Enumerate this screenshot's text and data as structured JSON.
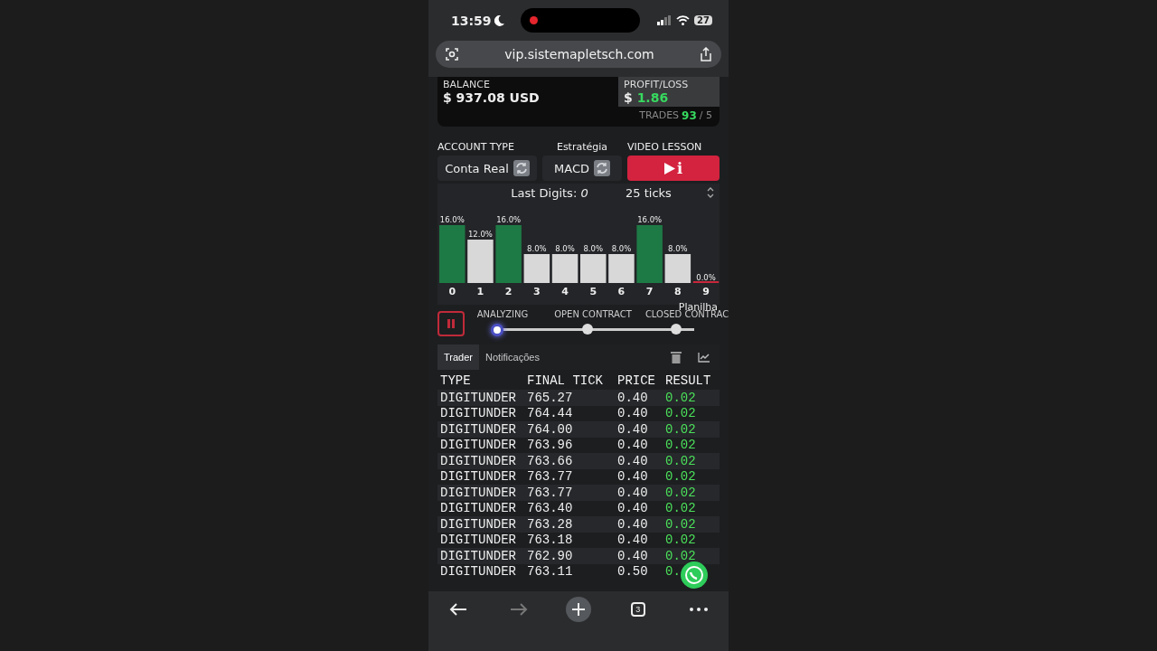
{
  "status_bar": {
    "time": "13:59",
    "battery": "27"
  },
  "address_bar": {
    "url": "vip.sistemapletsch.com"
  },
  "balance": {
    "label": "BALANCE",
    "value": "$ 937.08 USD"
  },
  "profit_loss": {
    "label": "PROFIT/LOSS",
    "currency": "$",
    "value": "1.86"
  },
  "trades": {
    "label": "TRADES",
    "count": "93",
    "limit": "/ 5"
  },
  "account_type": {
    "label": "ACCOUNT TYPE",
    "value": "Conta Real"
  },
  "strategy": {
    "label": "Estratégia",
    "value": "MACD"
  },
  "video_lesson": {
    "label": "VIDEO LESSON",
    "button_glyph": "i"
  },
  "digits": {
    "title": "Last Digits: *0*",
    "ticks": "25 ticks",
    "chart_data": {
      "type": "bar",
      "categories": [
        "0",
        "1",
        "2",
        "3",
        "4",
        "5",
        "6",
        "7",
        "8",
        "9"
      ],
      "series": [
        {
          "color": "#1e7a45",
          "values": [
            16,
            null,
            16,
            null,
            null,
            null,
            null,
            16,
            null,
            null
          ],
          "value_labels": [
            "16.0%",
            null,
            "16.0%",
            null,
            null,
            null,
            null,
            "16.0%",
            null,
            null
          ]
        },
        {
          "color": "#d8d8d8",
          "values": [
            null,
            12,
            null,
            8,
            8,
            8,
            8,
            null,
            8,
            null
          ],
          "value_labels": [
            null,
            "12.0%",
            null,
            "8.0%",
            "8.0%",
            "8.0%",
            "8.0%",
            null,
            "8.0%",
            null
          ]
        },
        {
          "color": "#c8283c",
          "values": [
            null,
            null,
            null,
            null,
            null,
            null,
            null,
            null,
            null,
            0
          ],
          "value_labels": [
            null,
            null,
            null,
            null,
            null,
            null,
            null,
            null,
            null,
            "0.0%"
          ]
        }
      ]
    }
  },
  "overlay_label": "Planilha",
  "steps": [
    {
      "label": "ANALYZING",
      "selected": true
    },
    {
      "label": "OPEN CONTRACT",
      "selected": false
    },
    {
      "label": "CLOSED CONTRAC",
      "selected": false
    }
  ],
  "tabs": [
    {
      "label": "Trader",
      "selected": true
    },
    {
      "label": "Notificações",
      "selected": false
    }
  ],
  "table": {
    "columns": [
      "TYPE",
      "FINAL TICK",
      "PRICE",
      "RESULT"
    ],
    "rows": [
      [
        "DIGITUNDER",
        "765.27",
        "0.40",
        "0.02"
      ],
      [
        "DIGITUNDER",
        "764.44",
        "0.40",
        "0.02"
      ],
      [
        "DIGITUNDER",
        "764.00",
        "0.40",
        "0.02"
      ],
      [
        "DIGITUNDER",
        "763.96",
        "0.40",
        "0.02"
      ],
      [
        "DIGITUNDER",
        "763.66",
        "0.40",
        "0.02"
      ],
      [
        "DIGITUNDER",
        "763.77",
        "0.40",
        "0.02"
      ],
      [
        "DIGITUNDER",
        "763.77",
        "0.40",
        "0.02"
      ],
      [
        "DIGITUNDER",
        "763.40",
        "0.40",
        "0.02"
      ],
      [
        "DIGITUNDER",
        "763.28",
        "0.40",
        "0.02"
      ],
      [
        "DIGITUNDER",
        "763.18",
        "0.40",
        "0.02"
      ],
      [
        "DIGITUNDER",
        "762.90",
        "0.40",
        "0.02"
      ],
      [
        "DIGITUNDER",
        "763.11",
        "0.50",
        "0."
      ]
    ]
  },
  "browser_toolbar": {
    "tab_count": "3",
    "forward_disabled": true
  }
}
